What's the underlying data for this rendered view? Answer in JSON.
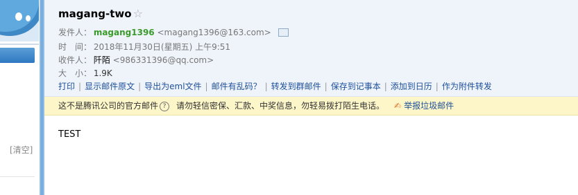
{
  "sidebar": {
    "clear_label": "[清空]"
  },
  "mail": {
    "subject": "magang-two",
    "star_icon": "☆",
    "from": {
      "label": "发件人：",
      "name": "magang1396",
      "address": "<magang1396@163.com>"
    },
    "time": {
      "label": "时　间：",
      "value": "2018年11月30日(星期五) 上午9:51"
    },
    "to": {
      "label": "收件人：",
      "name": "阡陌",
      "address": "<986331396@qq.com>"
    },
    "size": {
      "label": "大　小：",
      "value": "1.9K"
    },
    "actions": [
      "打印",
      "显示邮件原文",
      "导出为eml文件",
      "邮件有乱码？",
      "转发到群邮件",
      "保存到记事本",
      "添加到日历",
      "作为附件转发"
    ],
    "notice": {
      "official": "这不是腾讯公司的官方邮件",
      "help_icon": "?",
      "warning": "请勿轻信密保、汇款、中奖信息，勿轻易拨打陌生电话。",
      "report": "举报垃圾邮件"
    },
    "body": "TEST"
  }
}
